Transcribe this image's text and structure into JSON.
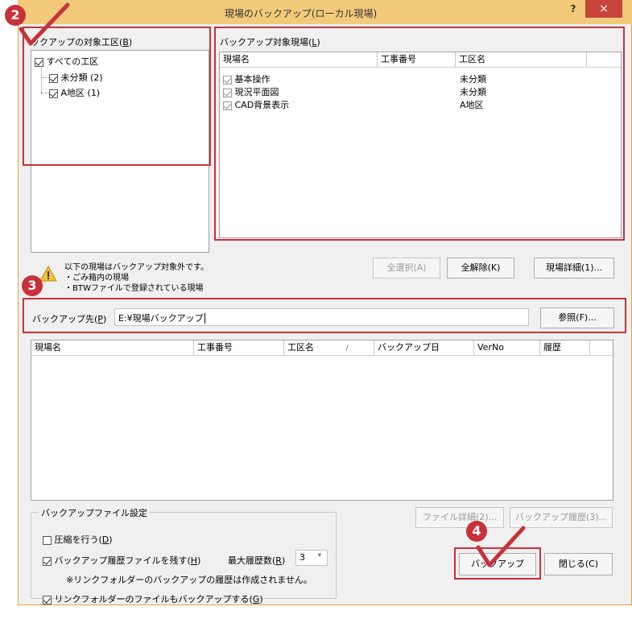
{
  "title": "現場のバックアップ(ローカル現場)",
  "titlebar": {
    "help_label": "?",
    "close_label": "×"
  },
  "tree": {
    "label": "ックアップの対象工区",
    "hotkey": "B",
    "items": [
      {
        "label": "すべての工区",
        "checked": true
      },
      {
        "label": "未分類 (2)",
        "checked": true
      },
      {
        "label": "A地区 (1)",
        "checked": true
      }
    ]
  },
  "targets": {
    "label": "バックアップ対象現場",
    "hotkey": "L",
    "columns": [
      "現場名",
      "工事番号",
      "工区名"
    ],
    "rows": [
      {
        "name": "基本操作",
        "number": "",
        "area": "未分類",
        "checked": true
      },
      {
        "name": "現況平面図",
        "number": "",
        "area": "未分類",
        "checked": true
      },
      {
        "name": "CAD背景表示",
        "number": "",
        "area": "A地区",
        "checked": true
      }
    ]
  },
  "notice": {
    "line1": "以下の現場はバックアップ対象外です。",
    "line2": "・ごみ箱内の現場",
    "line3": "・BTWファイルで登録されている現場"
  },
  "buttons": {
    "select_all": "全選択(A)",
    "clear_all": "全解除(K)",
    "site_detail": "現場詳細(1)...",
    "browse": "参照(F)...",
    "file_detail": "ファイル詳細(2)...",
    "history": "バックアップ履歴(3)...",
    "backup": "バックアップ",
    "close": "閉じる(C)"
  },
  "destination": {
    "label": "バックアップ先",
    "hotkey": "P",
    "value": "E:¥現場バックアップ"
  },
  "history_list": {
    "columns": [
      "現場名",
      "工事番号",
      "工区名",
      "バックアップ日",
      "VerNo",
      "履歴"
    ],
    "sort_indicator": "/"
  },
  "settings": {
    "group_label": "バックアップファイル設定",
    "compress": {
      "label": "圧縮を行う",
      "hotkey": "D",
      "checked": false
    },
    "keep_history": {
      "label": "バックアップ履歴ファイルを残す",
      "hotkey": "H",
      "checked": true
    },
    "max_history_label": "最大履歴数",
    "max_history_hotkey": "R",
    "max_history_value": "3",
    "note": "※リンクフォルダーのバックアップの履歴は作成されません。",
    "link_backup": {
      "label": "リンクフォルダーのファイルもバックアップする",
      "hotkey": "G",
      "checked": true
    }
  },
  "badges": [
    "2",
    "3",
    "4"
  ],
  "colors": {
    "highlight": "#c8313a",
    "titlebar": "#f2ca7a",
    "close": "#c8443a"
  }
}
